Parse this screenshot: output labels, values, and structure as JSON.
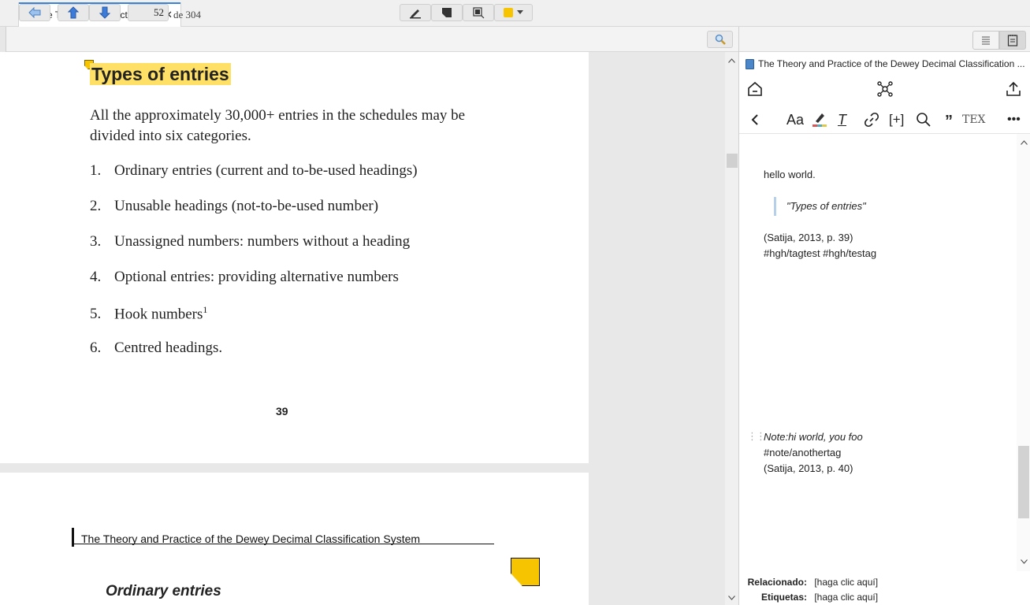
{
  "tab": {
    "title": "The Theory and Practice of ...",
    "close_glyph": "✕"
  },
  "toolbar": {
    "page_current": "52",
    "page_of": "de 304"
  },
  "pdf": {
    "heading": "Types of entries",
    "paragraph": "All the approximately 30,000+ entries in the schedules may be divided into six categories.",
    "list": [
      {
        "num": "1.",
        "text": "Ordinary entries (current and to-be-used headings)"
      },
      {
        "num": "2.",
        "text": "Unusable headings (not-to-be-used number)"
      },
      {
        "num": "3.",
        "text": "Unassigned numbers: numbers without a heading"
      },
      {
        "num": "4.",
        "text": "Optional entries: providing alternative numbers"
      },
      {
        "num": "5.",
        "text": "Hook numbers",
        "sup": "1"
      },
      {
        "num": "6.",
        "text": "Centred headings."
      }
    ],
    "page_number": "39",
    "page2_header": "The Theory and Practice of the Dewey Decimal Classification System",
    "page2_subheading": "Ordinary entries"
  },
  "note": {
    "title": "The Theory and Practice of the Dewey Decimal Classification ...",
    "line1": "hello world.",
    "quote": "\"Types of entries\"",
    "citation1": "(Satija, 2013, p. 39)",
    "tags1": "#hgh/tagtest #hgh/testag",
    "comment": "Note:hi world, you foo",
    "tag2": "#note/anothertag",
    "citation2": "(Satija, 2013, p. 40)"
  },
  "footer": {
    "related_label": "Relacionado:",
    "related_value": "[haga clic aquí]",
    "tags_label": "Etiquetas:",
    "tags_value": "[haga clic aquí]"
  },
  "colors": {
    "highlight": "#ffe066",
    "annotation": "#f6c400",
    "accent": "#3b82d6"
  }
}
